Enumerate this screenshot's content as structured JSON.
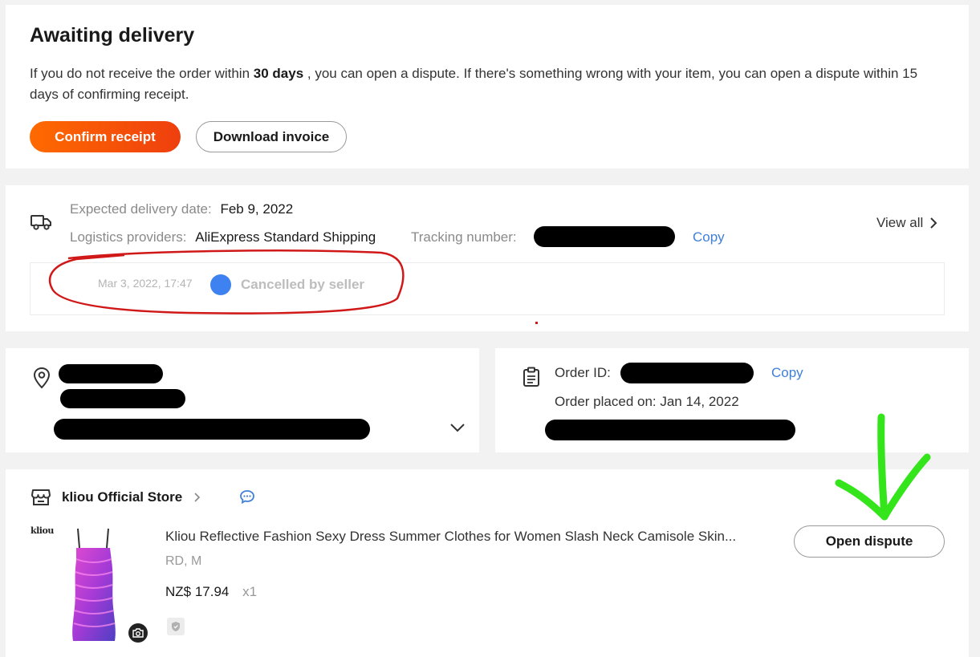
{
  "status": {
    "title": "Awaiting delivery",
    "desc_prefix": "If you do not receive the order within ",
    "desc_bold": "30 days",
    "desc_suffix": " , you can open a dispute. If there's something wrong with your item, you can open a dispute within 15 days of confirming receipt.",
    "confirm_label": "Confirm receipt",
    "download_label": "Download invoice"
  },
  "shipping": {
    "expected_label": "Expected delivery date:",
    "expected_value": "Feb 9, 2022",
    "logistics_label": "Logistics providers:",
    "logistics_value": "AliExpress Standard Shipping",
    "tracking_label": "Tracking number:",
    "copy_label": "Copy",
    "view_all_label": "View all",
    "event_time": "Mar 3, 2022, 17:47",
    "event_text": "Cancelled by seller"
  },
  "order": {
    "id_label": "Order ID:",
    "copy_label": "Copy",
    "placed_label": "Order placed on: Jan 14, 2022"
  },
  "store": {
    "name": "kliou Official Store",
    "brand_logo_text": "kliou",
    "product_title": "Kliou Reflective Fashion Sexy Dress Summer Clothes for Women Slash Neck Camisole Skin...",
    "variant": "RD, M",
    "price": "NZ$ 17.94",
    "quantity": "x1",
    "dispute_label": "Open dispute"
  },
  "colors": {
    "accent_start": "#ff6a00",
    "accent_end": "#ee3f0e",
    "link": "#3f7fd8",
    "annotation_red": "#d01818",
    "annotation_green": "#33e51a",
    "timeline_dot": "#3d82f0"
  }
}
